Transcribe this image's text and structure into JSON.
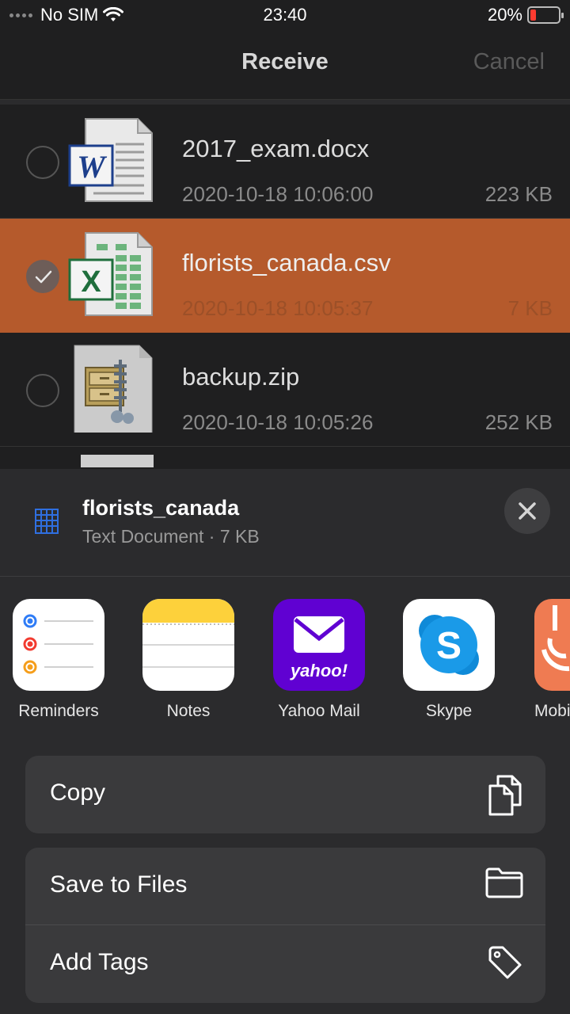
{
  "status": {
    "carrier": "No SIM",
    "time": "23:40",
    "battery": "20%",
    "battery_level": 0.2
  },
  "header": {
    "title": "Receive",
    "cancel": "Cancel"
  },
  "files": [
    {
      "name": "2017_exam.docx",
      "date": "2020-10-18 10:06:00",
      "size": "223 KB",
      "icon": "word-document-icon",
      "selected": false
    },
    {
      "name": "florists_canada.csv",
      "date": "2020-10-18 10:05:37",
      "size": "7 KB",
      "icon": "excel-document-icon",
      "selected": true
    },
    {
      "name": "backup.zip",
      "date": "2020-10-18 10:05:26",
      "size": "252 KB",
      "icon": "zip-archive-icon",
      "selected": false
    }
  ],
  "preview": {
    "name": "florists_canada",
    "meta": "Text Document · 7 KB"
  },
  "apps": [
    {
      "label": "Reminders",
      "icon": "reminders-app-icon"
    },
    {
      "label": "Notes",
      "icon": "notes-app-icon"
    },
    {
      "label": "Yahoo Mail",
      "icon": "yahoo-mail-app-icon",
      "logo_text": "yahoo!"
    },
    {
      "label": "Skype",
      "icon": "skype-app-icon",
      "logo_text": "S"
    },
    {
      "label": "Mobi",
      "icon": "mobi-app-icon"
    }
  ],
  "actions": {
    "copy": "Copy",
    "save_to_files": "Save to Files",
    "add_tags": "Add Tags"
  },
  "colors": {
    "selected_row": "#b55a2c",
    "battery_low": "#ff3b30",
    "yahoo": "#6001d2",
    "skype": "#0f8ad8"
  }
}
